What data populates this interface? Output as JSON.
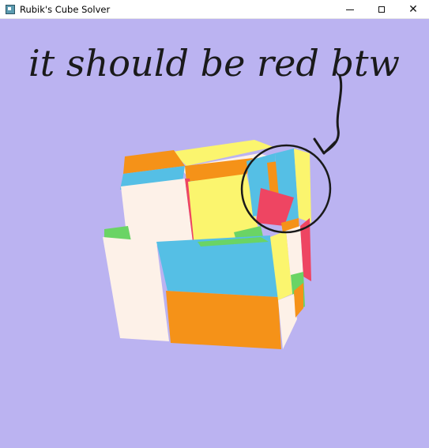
{
  "window": {
    "title": "Rubik's Cube Solver",
    "icon": "app-icon",
    "controls": {
      "minimize": "minimize-icon",
      "maximize": "maximize-icon",
      "close": "close-icon"
    }
  },
  "viewport": {
    "background": "#bbb3f1"
  },
  "cube_colors": {
    "white": "#fdf1e8",
    "orange": "#f59218",
    "blue": "#55bfe5",
    "yellow": "#fbf56e",
    "red": "#ee4562",
    "green": "#6ad465"
  },
  "annotation": {
    "text": "it should be red btw",
    "ink_color": "#1a1a1a"
  }
}
